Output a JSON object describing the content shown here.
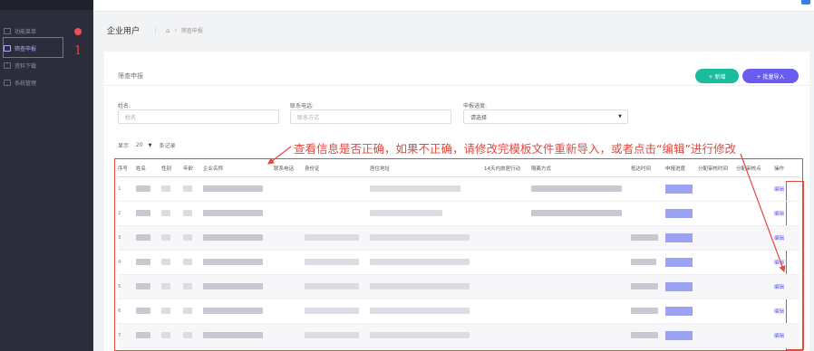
{
  "sidebar": {
    "items": [
      {
        "label": "功能菜单",
        "icon": "menu-icon"
      },
      {
        "label": "筛查申报",
        "icon": "edit-icon"
      },
      {
        "label": "资料下载",
        "icon": "download-icon"
      },
      {
        "label": "系统管理",
        "icon": "settings-icon"
      }
    ]
  },
  "annotation_step": "1",
  "header": {
    "title": "企业用户",
    "crumb": "筛查申报"
  },
  "card": {
    "title": "筛查申报",
    "add_label": "+ 新增",
    "import_label": "+ 批量导入"
  },
  "filters": {
    "name_label": "姓名:",
    "name_placeholder": "姓名",
    "phone_label": "联系电话:",
    "phone_placeholder": "联系方式",
    "status_label": "申报进度:",
    "status_value": "请选择"
  },
  "paging": {
    "show_label": "显示",
    "page_size": "20",
    "records_label": "条记录"
  },
  "annotation_text": "查看信息是否正确，如果不正确，请修改完模板文件重新导入，或者点击“编辑”进行修改",
  "table": {
    "headers": [
      "序号",
      "姓名",
      "性别",
      "年龄",
      "企业名称",
      "联系电话",
      "身份证",
      "居住地址",
      "14天内旅居行动",
      "隔离方式",
      "抵达时间",
      "申报进度",
      "分配审核时间",
      "分配审核点",
      "操作"
    ],
    "rows": [
      {
        "no": "1",
        "op": "编辑"
      },
      {
        "no": "2",
        "op": "编辑"
      },
      {
        "no": "3",
        "op": "编辑"
      },
      {
        "no": "4",
        "op": "编辑"
      },
      {
        "no": "5",
        "op": "编辑"
      },
      {
        "no": "6",
        "op": "编辑"
      },
      {
        "no": "7",
        "op": "编辑"
      }
    ]
  },
  "colors": {
    "accent": "#6a5cf0",
    "add": "#1abc9c",
    "annotation": "#e5483f",
    "sidebar": "#2b2d3a"
  }
}
